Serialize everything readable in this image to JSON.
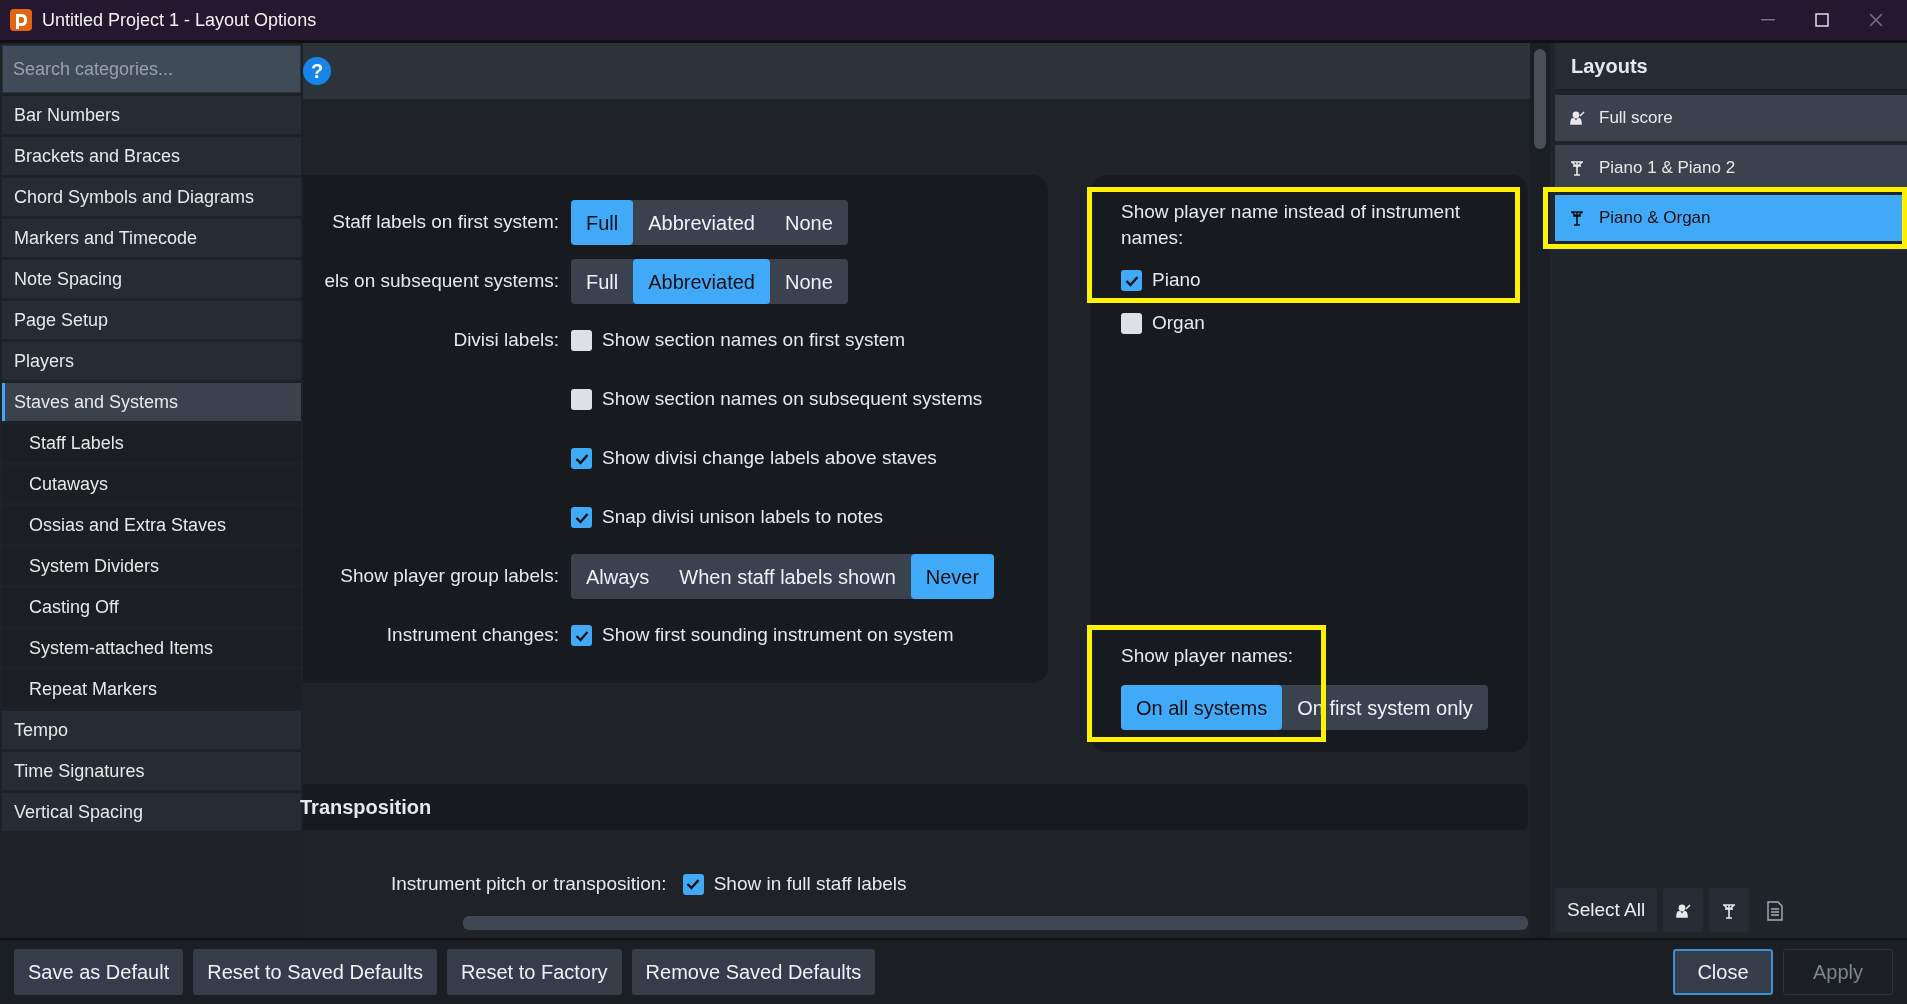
{
  "window": {
    "title": "Untitled Project 1 - Layout Options"
  },
  "sidebar": {
    "search": {
      "placeholder": "Search categories..."
    },
    "items": [
      {
        "label": "Bar Numbers",
        "selected": false
      },
      {
        "label": "Brackets and Braces",
        "selected": false
      },
      {
        "label": "Chord Symbols and Diagrams",
        "selected": false
      },
      {
        "label": "Markers and Timecode",
        "selected": false
      },
      {
        "label": "Note Spacing",
        "selected": false
      },
      {
        "label": "Page Setup",
        "selected": false
      },
      {
        "label": "Players",
        "selected": false
      },
      {
        "label": "Staves and Systems",
        "selected": true,
        "children": [
          {
            "label": "Staff Labels",
            "selected": false
          },
          {
            "label": "Cutaways",
            "selected": false
          },
          {
            "label": "Ossias and Extra Staves",
            "selected": false
          },
          {
            "label": "System Dividers",
            "selected": false
          },
          {
            "label": "Casting Off",
            "selected": false
          },
          {
            "label": "System-attached Items",
            "selected": false
          },
          {
            "label": "Repeat Markers",
            "selected": false
          }
        ]
      },
      {
        "label": "Tempo",
        "selected": false
      },
      {
        "label": "Time Signatures",
        "selected": false
      },
      {
        "label": "Vertical Spacing",
        "selected": false
      }
    ]
  },
  "help": {
    "label": "?"
  },
  "options": {
    "rows": [
      {
        "kind": "segmented",
        "label": "Staff labels on first system:",
        "options": [
          {
            "label": "Full",
            "selected": true
          },
          {
            "label": "Abbreviated",
            "selected": false
          },
          {
            "label": "None",
            "selected": false
          }
        ]
      },
      {
        "kind": "segmented",
        "label": "els on subsequent systems:",
        "options": [
          {
            "label": "Full",
            "selected": false
          },
          {
            "label": "Abbreviated",
            "selected": true
          },
          {
            "label": "None",
            "selected": false
          }
        ]
      },
      {
        "kind": "checkbox",
        "label": "Divisi labels:",
        "text": "Show section names on first system",
        "checked": false
      },
      {
        "kind": "checkbox",
        "text": "Show section names on subsequent systems",
        "checked": false
      },
      {
        "kind": "checkbox",
        "text": "Show divisi change labels above staves",
        "checked": true
      },
      {
        "kind": "checkbox",
        "text": "Snap divisi unison labels to notes",
        "checked": true
      },
      {
        "kind": "segmented",
        "label": "Show player group labels:",
        "options": [
          {
            "label": "Always",
            "selected": false
          },
          {
            "label": "When staff labels shown",
            "selected": false
          },
          {
            "label": "Never",
            "selected": true
          }
        ]
      },
      {
        "kind": "checkbox",
        "label": "Instrument changes:",
        "text": "Show first sounding instrument on system",
        "checked": true
      }
    ]
  },
  "player_names": {
    "heading": "Show player name instead of instrument names:",
    "highlight": true,
    "players": [
      {
        "label": "Piano",
        "checked": true
      },
      {
        "label": "Organ",
        "checked": false
      }
    ],
    "show_names": {
      "label": "Show player names:",
      "highlight": true,
      "options": [
        {
          "label": "On all systems",
          "selected": true
        },
        {
          "label": "On first system only",
          "selected": false
        }
      ]
    }
  },
  "transposition": {
    "heading": "Transposition",
    "rows": [
      {
        "label": "Instrument pitch or transposition:",
        "text": "Show in full staff labels",
        "checked": true
      }
    ]
  },
  "layouts": {
    "title": "Layouts",
    "items": [
      {
        "label": "Full score",
        "kind": "conductor",
        "selected": false,
        "highlight": false
      },
      {
        "label": "Piano 1 & Piano 2",
        "kind": "stand",
        "selected": false,
        "highlight": false
      },
      {
        "label": "Piano & Organ",
        "kind": "stand",
        "selected": true,
        "highlight": true
      }
    ],
    "select_all": "Select All"
  },
  "footer": {
    "left_buttons": [
      "Save as Default",
      "Reset to Saved Defaults",
      "Reset to Factory",
      "Remove Saved Defaults"
    ],
    "close": "Close",
    "apply": {
      "label": "Apply",
      "disabled": true
    }
  }
}
